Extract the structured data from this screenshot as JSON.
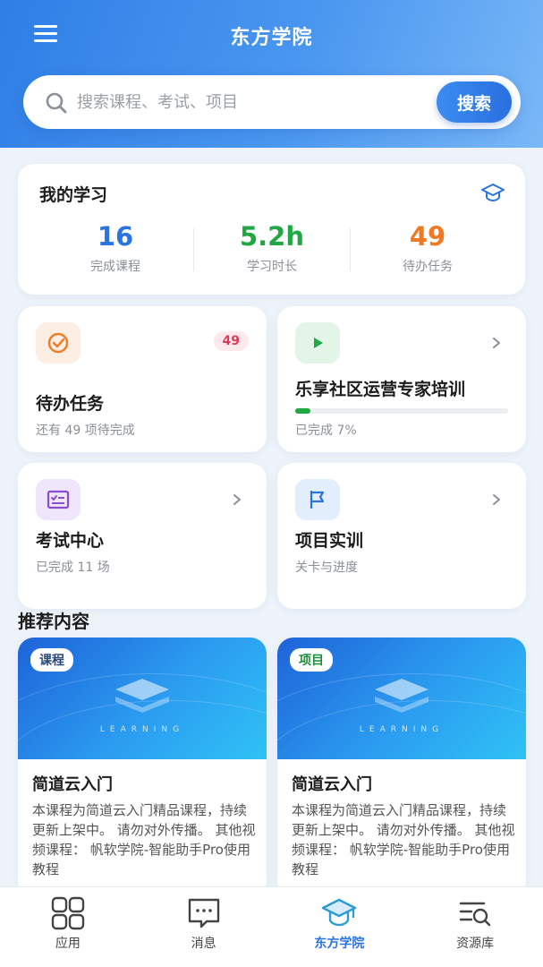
{
  "header": {
    "title": "东方学院"
  },
  "search": {
    "placeholder": "搜索课程、考试、项目",
    "button_label": "搜索"
  },
  "my_study": {
    "title": "我的学习",
    "stats": [
      {
        "value": "16",
        "label": "完成课程",
        "color": "#2a74e0"
      },
      {
        "value": "5.2h",
        "label": "学习时长",
        "color": "#22a745"
      },
      {
        "value": "49",
        "label": "待办任务",
        "color": "#f07a24"
      }
    ]
  },
  "tiles": {
    "todo": {
      "title": "待办任务",
      "badge": "49",
      "subtitle": "还有 49 项待完成"
    },
    "training": {
      "title": "乐享社区运营专家培训",
      "subtitle": "已完成 7%",
      "progress": 0.07
    },
    "exam": {
      "title": "考试中心",
      "subtitle": "已完成 11 场"
    },
    "project": {
      "title": "项目实训",
      "subtitle": "关卡与进度"
    }
  },
  "recommend": {
    "title": "推荐内容",
    "items": [
      {
        "tag": "课程",
        "tag_color": "#2a4a7a",
        "cover_text": "LEARNING",
        "name": "简道云入门",
        "desc": "本课程为简道云入门精品课程，持续更新上架中。 请勿对外传播。 其他视频课程： 帆软学院-智能助手Pro使用教程"
      },
      {
        "tag": "项目",
        "tag_color": "#1e8c3a",
        "cover_text": "LEARNING",
        "name": "简道云入门",
        "desc": "本课程为简道云入门精品课程，持续更新上架中。 请勿对外传播。 其他视频课程： 帆软学院-智能助手Pro使用教程"
      }
    ]
  },
  "tabbar": {
    "items": [
      {
        "label": "应用",
        "icon": "grid-icon"
      },
      {
        "label": "消息",
        "icon": "message-icon"
      },
      {
        "label": "东方学院",
        "icon": "graduation-cap-icon",
        "active": true
      },
      {
        "label": "资源库",
        "icon": "search-list-icon"
      }
    ]
  }
}
